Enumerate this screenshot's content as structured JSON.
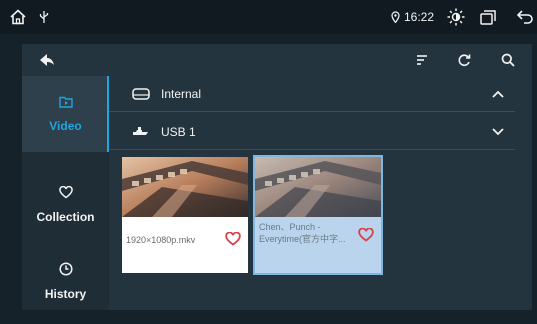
{
  "status_bar": {
    "time": "16:22",
    "icons": [
      "home-icon",
      "usb-icon",
      "location-icon",
      "brightness-icon",
      "window-icon",
      "back-icon"
    ]
  },
  "toolbar": {
    "icons": [
      "back-arrow-icon",
      "sort-icon",
      "refresh-icon",
      "search-icon"
    ]
  },
  "sidebar": {
    "items": [
      {
        "label": "Video",
        "icon": "video-folder-icon",
        "active": true
      },
      {
        "label": "Collection",
        "icon": "heart-icon",
        "active": false
      },
      {
        "label": "History",
        "icon": "clock-icon",
        "active": false
      }
    ]
  },
  "storage": [
    {
      "label": "Internal",
      "icon": "drive-icon",
      "expanded": true
    },
    {
      "label": "USB 1",
      "icon": "usb-drive-icon",
      "expanded": false
    }
  ],
  "files": [
    {
      "name": "1920×1080p.mkv",
      "selected": false
    },
    {
      "name": "Chen、Punch - Everytime(官方中字...",
      "selected": true
    }
  ],
  "colors": {
    "accent": "#20a5e0",
    "heart": "#d8424a",
    "panel": "#24343f",
    "card_selected": "#b9d4ec"
  }
}
